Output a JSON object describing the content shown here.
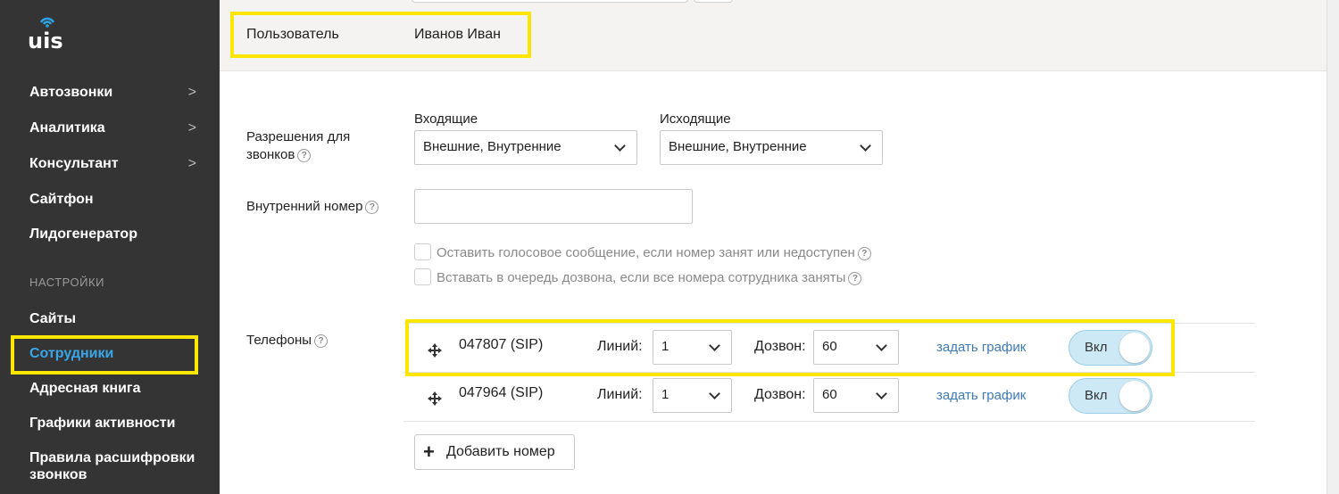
{
  "sidebar": {
    "logo_text": "uiS",
    "items": [
      {
        "label": "Автозвонки",
        "chevron": ">"
      },
      {
        "label": "Аналитика",
        "chevron": ">"
      },
      {
        "label": "Консультант",
        "chevron": ">"
      },
      {
        "label": "Сайтфон"
      },
      {
        "label": "Лидогенератор"
      }
    ],
    "section_title": "НАСТРОЙКИ",
    "settings_items": [
      {
        "label": "Сайты"
      },
      {
        "label": "Сотрудники",
        "active": true
      },
      {
        "label": "Адресная книга"
      },
      {
        "label": "Графики активности"
      },
      {
        "label": "Правила расшифровки звонков"
      }
    ]
  },
  "header": {
    "user_label": "Пользователь",
    "user_value": "Иванов Иван"
  },
  "form": {
    "permissions_label": "Разрешения для звонков",
    "incoming_label": "Входящие",
    "incoming_value": "Внешние, Внутренние",
    "outgoing_label": "Исходящие",
    "outgoing_value": "Внешние, Внутренние",
    "internal_number_label": "Внутренний номер",
    "internal_number_value": "",
    "voicemail_label": "Оставить голосовое сообщение, если номер занят или недоступен",
    "voicemail_checked": false,
    "queue_label": "Вставать в очередь дозвона, если все номера сотрудника заняты",
    "queue_checked": false,
    "phones_label": "Телефоны",
    "help_glyph": "?"
  },
  "phones": [
    {
      "number": "047807 (SIP)",
      "lines_label": "Линий:",
      "lines_value": "1",
      "dial_label": "Дозвон:",
      "dial_value": "60",
      "schedule_link": "задать график",
      "toggle_label": "Вкл",
      "enabled": true
    },
    {
      "number": "047964 (SIP)",
      "lines_label": "Линий:",
      "lines_value": "1",
      "dial_label": "Дозвон:",
      "dial_value": "60",
      "schedule_link": "задать график",
      "toggle_label": "Вкл",
      "enabled": true
    }
  ],
  "add_number_button": {
    "plus": "+",
    "label": "Добавить номер"
  },
  "colors": {
    "sidebar_bg": "#343434",
    "active_nav": "#3aa6e8",
    "highlight": "#ffe600",
    "link": "#3d7ab8",
    "toggle_on": "#cde9f6"
  }
}
